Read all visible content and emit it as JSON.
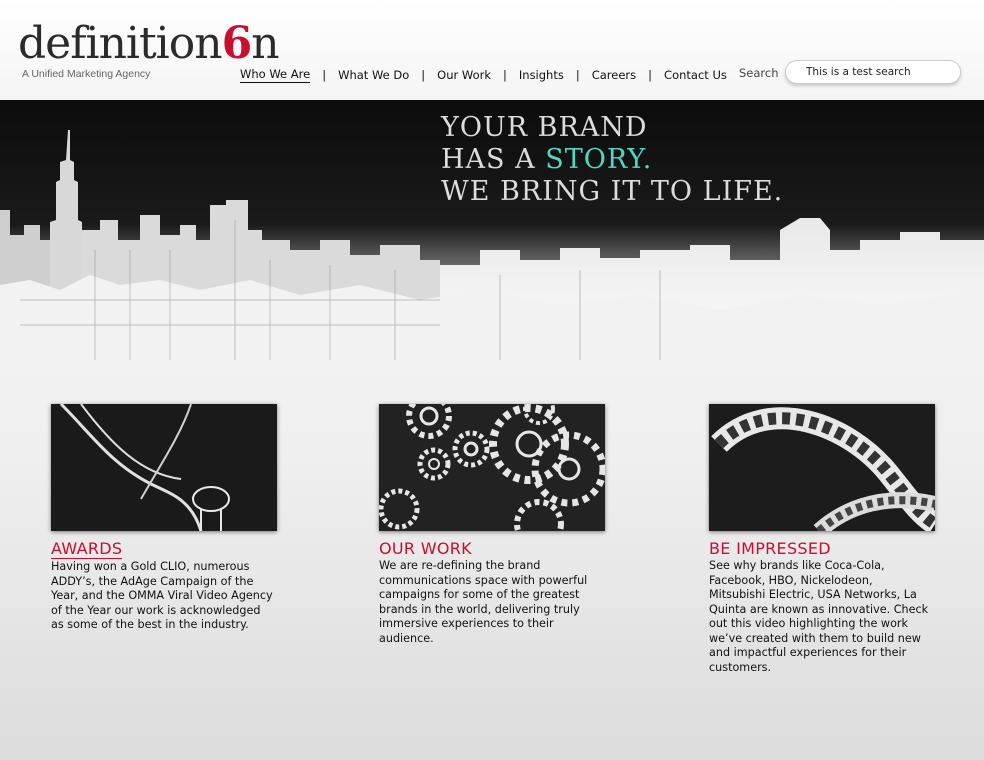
{
  "header": {
    "logo": {
      "wordmark": "definition",
      "six": "6",
      "tagline": "A Unified Marketing Agency"
    },
    "nav": [
      {
        "label": "Who We Are",
        "active": true
      },
      {
        "label": "What We Do",
        "active": false
      },
      {
        "label": "Our Work",
        "active": false
      },
      {
        "label": "Insights",
        "active": false
      },
      {
        "label": "Careers",
        "active": false
      },
      {
        "label": "Contact Us",
        "active": false
      }
    ],
    "nav_separator": "|",
    "search": {
      "label": "Search",
      "value": "This is a test search"
    }
  },
  "hero": {
    "line1": "YOUR BRAND",
    "line2_prefix": "HAS A ",
    "line2_accent": "STORY.",
    "line3": "WE BRING IT TO LIFE."
  },
  "cards": [
    {
      "title": "AWARDS",
      "thumb_icon": "award-statuette-icon",
      "body": "Having won a Gold CLIO, numerous ADDY’s, the AdAge Campaign of the Year, and the OMMA Viral Video Agency of the Year our work is acknowledged as some of the best in the industry."
    },
    {
      "title": "OUR WORK",
      "thumb_icon": "gears-icon",
      "body": "We are re-defining the brand communications space with powerful campaigns for some of the greatest brands in the world, delivering truly immersive experiences to their audience."
    },
    {
      "title": "BE IMPRESSED",
      "thumb_icon": "film-strip-icon",
      "body": "See why brands like Coca-Cola, Facebook, HBO, Nickelodeon, Mitsubishi Electric, USA Networks, La Quinta are known as innovative. Check out this video highlighting the work we’ve created with them to build new and impactful experiences for their customers."
    }
  ],
  "colors": {
    "brand_red": "#c8102e",
    "accent_teal": "#52d6c2",
    "text": "#111111"
  }
}
